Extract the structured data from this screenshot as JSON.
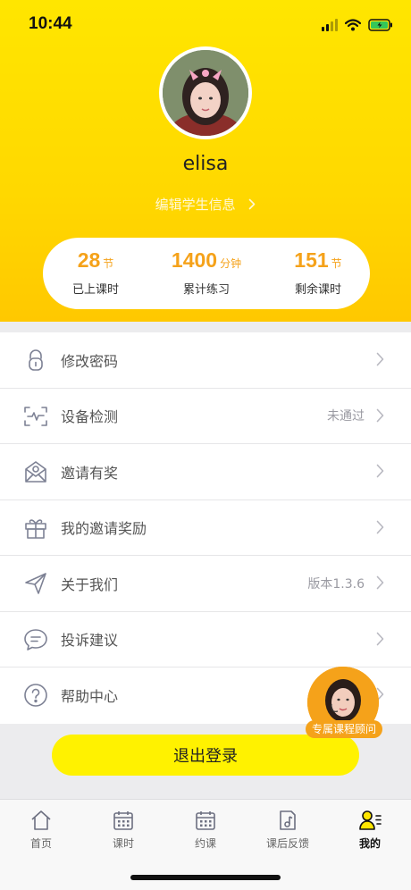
{
  "status_bar": {
    "time": "10:44"
  },
  "profile": {
    "username": "elisa",
    "edit_label": "编辑学生信息",
    "edit_chevron": "›"
  },
  "stats": [
    {
      "value": "28",
      "unit": "节",
      "label": "已上课时"
    },
    {
      "value": "1400",
      "unit": "分钟",
      "label": "累计练习"
    },
    {
      "value": "151",
      "unit": "节",
      "label": "剩余课时"
    }
  ],
  "menu": {
    "items": [
      {
        "label": "修改密码",
        "value": "",
        "icon": "lock-icon"
      },
      {
        "label": "设备检测",
        "value": "未通过",
        "icon": "device-check-icon"
      },
      {
        "label": "邀请有奖",
        "value": "",
        "icon": "envelope-icon"
      },
      {
        "label": "我的邀请奖励",
        "value": "",
        "icon": "gift-icon"
      },
      {
        "label": "关于我们",
        "value": "版本1.3.6",
        "icon": "paper-plane-icon"
      },
      {
        "label": "投诉建议",
        "value": "",
        "icon": "chat-bubble-icon"
      },
      {
        "label": "帮助中心",
        "value": "",
        "icon": "question-icon"
      }
    ]
  },
  "logout": {
    "label": "退出登录"
  },
  "advisor": {
    "label": "专属课程顾问"
  },
  "tabbar": {
    "tabs": [
      {
        "label": "首页",
        "icon": "home-icon",
        "active": false
      },
      {
        "label": "课时",
        "icon": "calendar-icon",
        "active": false
      },
      {
        "label": "约课",
        "icon": "calendar-icon",
        "active": false
      },
      {
        "label": "课后反馈",
        "icon": "feedback-icon",
        "active": false
      },
      {
        "label": "我的",
        "icon": "profile-icon",
        "active": true
      }
    ]
  },
  "colors": {
    "accent_yellow": "#ffe600",
    "stat_orange": "#f5a21a",
    "button_yellow": "#fff200"
  }
}
